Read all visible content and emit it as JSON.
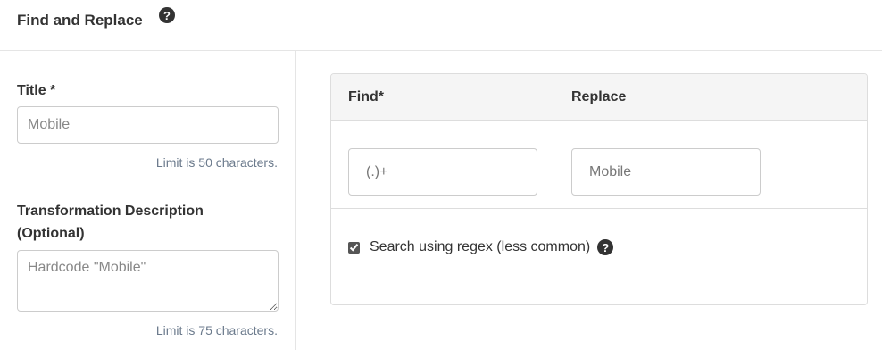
{
  "header": {
    "title": "Find and Replace",
    "help_icon": "?"
  },
  "form": {
    "title_label": "Title *",
    "title_placeholder": "Mobile",
    "title_hint": "Limit is 50 characters.",
    "description_label": "Transformation Description (Optional)",
    "description_placeholder": "Hardcode \"Mobile\"",
    "description_hint": "Limit is 75 characters."
  },
  "find_replace": {
    "find_header": "Find*",
    "replace_header": "Replace",
    "find_placeholder": "(.)+",
    "replace_placeholder": "Mobile",
    "regex_label": "Search using regex (less common)",
    "regex_checked": true,
    "help_icon": "?"
  }
}
